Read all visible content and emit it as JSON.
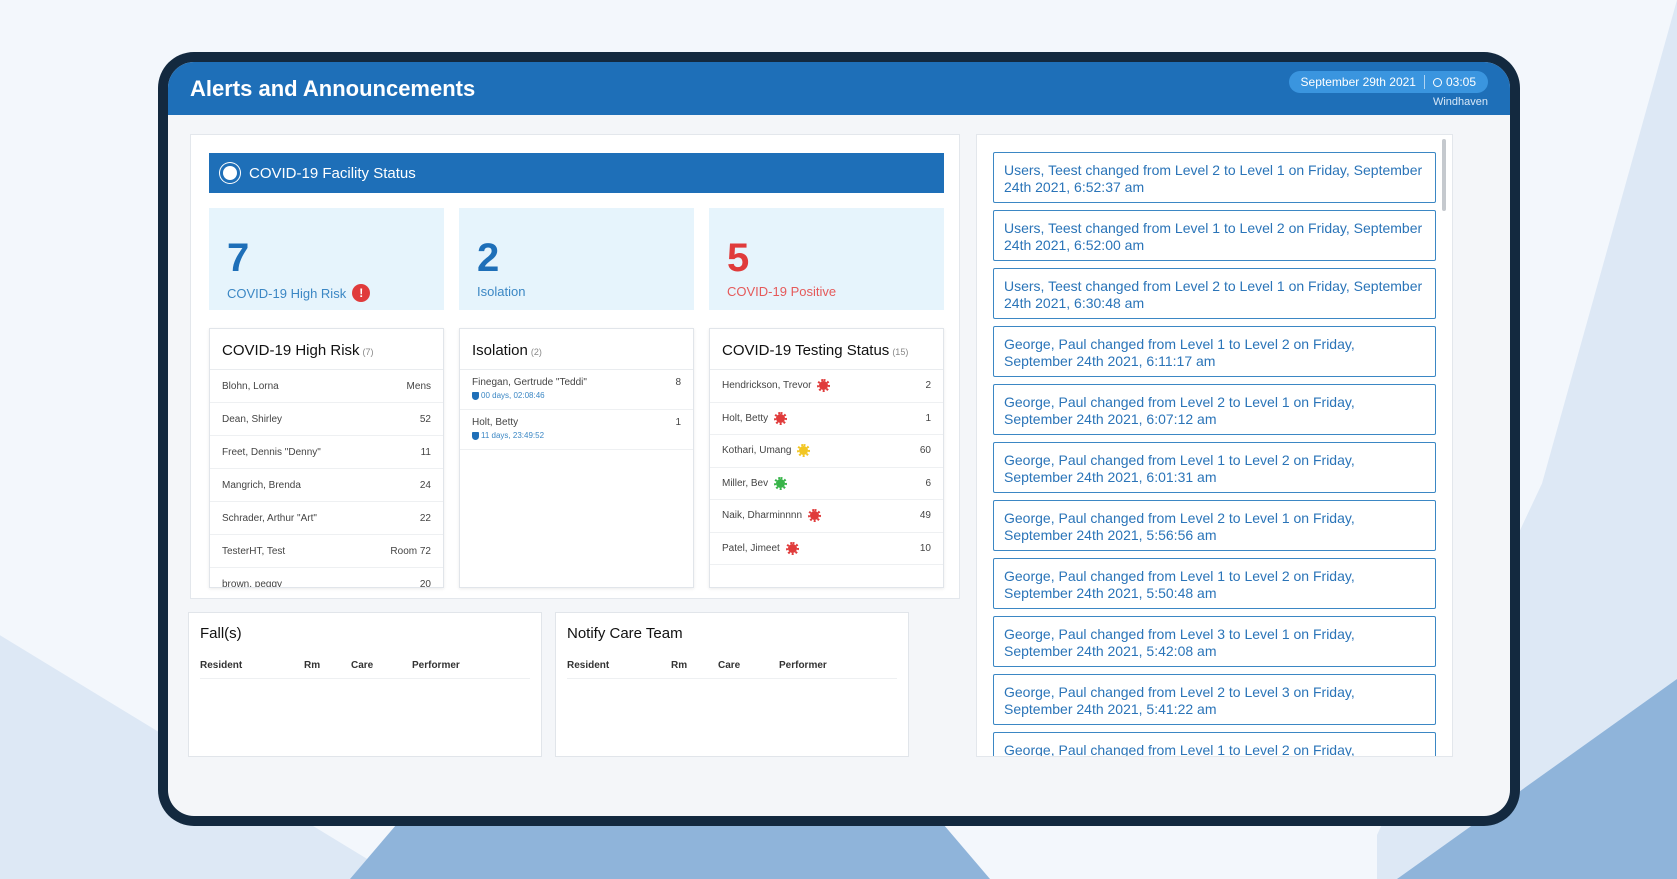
{
  "header": {
    "title": "Alerts and Announcements",
    "date": "September 29th 2021",
    "time": "03:05",
    "facility": "Windhaven"
  },
  "facility_status": {
    "title": "COVID-19 Facility Status",
    "stats": [
      {
        "value": "7",
        "label": "COVID-19 High Risk"
      },
      {
        "value": "2",
        "label": "Isolation"
      },
      {
        "value": "5",
        "label": "COVID-19 Positive"
      }
    ]
  },
  "high_risk": {
    "title": "COVID-19 High Risk",
    "count": "(7)",
    "rows": [
      {
        "name": "Blohn, Lorna",
        "room": "Mens"
      },
      {
        "name": "Dean, Shirley",
        "room": "52"
      },
      {
        "name": "Freet, Dennis \"Denny\"",
        "room": "11"
      },
      {
        "name": "Mangrich, Brenda",
        "room": "24"
      },
      {
        "name": "Schrader, Arthur \"Art\"",
        "room": "22"
      },
      {
        "name": "TesterHT, Test",
        "room": "Room 72"
      },
      {
        "name": "brown, peggy",
        "room": "20"
      }
    ]
  },
  "isolation": {
    "title": "Isolation",
    "count": "(2)",
    "rows": [
      {
        "name": "Finegan, Gertrude \"Teddi\"",
        "duration": "00 days, 02:08:46",
        "room": "8"
      },
      {
        "name": "Holt, Betty",
        "duration": "11 days, 23:49:52",
        "room": "1"
      }
    ]
  },
  "testing": {
    "title": "COVID-19 Testing Status",
    "count": "(15)",
    "rows": [
      {
        "name": "Hendrickson, Trevor",
        "status": "red",
        "room": "2"
      },
      {
        "name": "Holt, Betty",
        "status": "red",
        "room": "1"
      },
      {
        "name": "Kothari, Umang",
        "status": "yellow",
        "room": "60"
      },
      {
        "name": "Miller, Bev",
        "status": "green",
        "room": "6"
      },
      {
        "name": "Naik, Dharminnnn",
        "status": "red",
        "room": "49"
      },
      {
        "name": "Patel, Jimeet",
        "status": "red",
        "room": "10"
      }
    ]
  },
  "falls": {
    "title": "Fall(s)",
    "columns": [
      "Resident",
      "Rm",
      "Care",
      "Performer"
    ]
  },
  "notify": {
    "title": "Notify Care Team",
    "columns": [
      "Resident",
      "Rm",
      "Care",
      "Performer"
    ]
  },
  "announcements": [
    "Users, Teest changed from Level 2 to Level 1 on Friday, September 24th 2021, 6:52:37 am",
    "Users, Teest changed from Level 1 to Level 2 on Friday, September 24th 2021, 6:52:00 am",
    "Users, Teest changed from Level 2 to Level 1 on Friday, September 24th 2021, 6:30:48 am",
    "George, Paul changed from Level 1 to Level 2 on Friday, September 24th 2021, 6:11:17 am",
    "George, Paul changed from Level 2 to Level 1 on Friday, September 24th 2021, 6:07:12 am",
    "George, Paul changed from Level 1 to Level 2 on Friday, September 24th 2021, 6:01:31 am",
    "George, Paul changed from Level 2 to Level 1 on Friday, September 24th 2021, 5:56:56 am",
    "George, Paul changed from Level 1 to Level 2 on Friday, September 24th 2021, 5:50:48 am",
    "George, Paul changed from Level 3 to Level 1 on Friday, September 24th 2021, 5:42:08 am",
    "George, Paul changed from Level 2 to Level 3 on Friday, September 24th 2021, 5:41:22 am",
    "George, Paul changed from Level 1 to Level 2 on Friday,"
  ]
}
